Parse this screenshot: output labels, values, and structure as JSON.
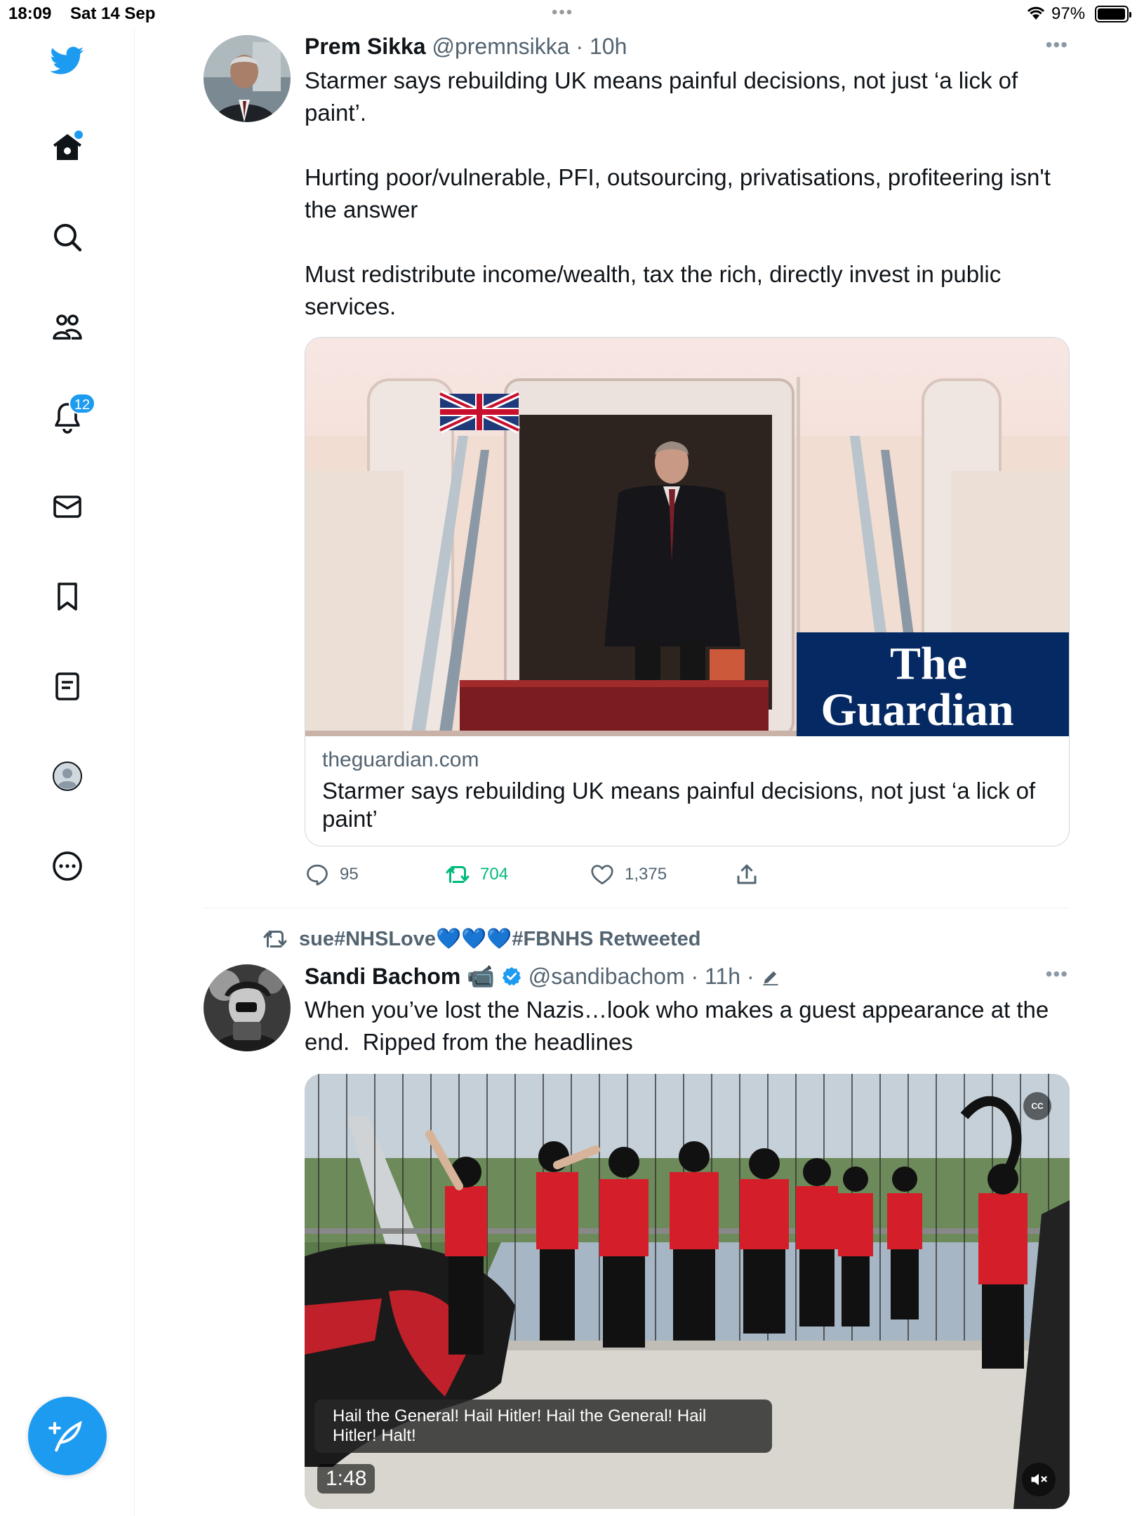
{
  "status_bar": {
    "time": "18:09",
    "date": "Sat 14 Sep",
    "battery": "97%",
    "battery_level": 0.97
  },
  "sidebar": {
    "items": [
      {
        "name": "twitter-logo",
        "icon": "bird-icon"
      },
      {
        "name": "home",
        "icon": "home-icon",
        "has_dot": true
      },
      {
        "name": "explore",
        "icon": "search-icon"
      },
      {
        "name": "communities",
        "icon": "people-icon"
      },
      {
        "name": "notifications",
        "icon": "bell-icon",
        "badge": "12"
      },
      {
        "name": "messages",
        "icon": "mail-icon"
      },
      {
        "name": "bookmarks",
        "icon": "bookmark-icon"
      },
      {
        "name": "lists",
        "icon": "list-icon"
      },
      {
        "name": "profile",
        "icon": "avatar-icon"
      },
      {
        "name": "more",
        "icon": "more-circle-icon"
      }
    ],
    "compose_icon": "compose-feather-icon"
  },
  "accent_color": "#1d9bf0",
  "retweet_color": "#00ba7c",
  "tweets": [
    {
      "name": "Prem Sikka",
      "handle": "@premnsikka",
      "time": "10h",
      "text": "Starmer says rebuilding UK means painful decisions, not just ‘a lick of paint’.\n\nHurting poor/vulnerable, PFI, outsourcing, privatisations, profiteering isn't the answer\n\nMust redistribute income/wealth, tax the rich, directly invest in public services.",
      "card": {
        "image_logo_line1": "The",
        "image_logo_line2": "Guardian",
        "domain": "theguardian.com",
        "title": "Starmer says rebuilding UK means painful decisions, not just ‘a lick of paint’"
      },
      "replies": "95",
      "retweets": "704",
      "likes": "1,375"
    },
    {
      "retweeted_by": "sue#NHSLove💙💙💙#FBNHS Retweeted",
      "name": "Sandi Bachom",
      "name_emoji": "📹",
      "verified": true,
      "handle": "@sandibachom",
      "time": "11h",
      "edited": true,
      "text": "When you’ve lost the Nazis…look who makes a guest appearance at the end.  Ripped from the headlines",
      "video": {
        "caption": "Hail the General! Hail Hitler! Hail the General! Hail Hitler! Halt!",
        "duration": "1:48",
        "cc_label": "CC"
      }
    }
  ]
}
